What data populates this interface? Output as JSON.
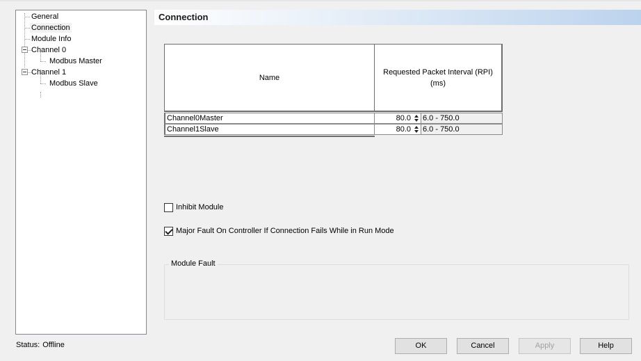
{
  "tree": {
    "items": [
      {
        "label": "General"
      },
      {
        "label": "Connection"
      },
      {
        "label": "Module Info"
      },
      {
        "label": "Channel 0"
      },
      {
        "label": "Modbus Master"
      },
      {
        "label": "Channel 1"
      },
      {
        "label": "Modbus Slave"
      }
    ]
  },
  "section": {
    "title": "Connection"
  },
  "table": {
    "headers": {
      "name": "Name",
      "rpi": "Requested Packet Interval (RPI) (ms)"
    },
    "rows": [
      {
        "name": "Channel0Master",
        "rpi": "80.0",
        "range": "6.0 - 750.0"
      },
      {
        "name": "Channel1Slave",
        "rpi": "80.0",
        "range": "6.0 - 750.0"
      }
    ]
  },
  "options": {
    "inhibit_module": {
      "label": "Inhibit Module",
      "checked": false
    },
    "major_fault": {
      "label": "Major Fault On Controller If Connection Fails While in Run Mode",
      "checked": true
    }
  },
  "module_fault": {
    "label": "Module Fault"
  },
  "status": {
    "label": "Status:",
    "value": "Offline"
  },
  "buttons": {
    "ok": "OK",
    "cancel": "Cancel",
    "apply": "Apply",
    "help": "Help"
  },
  "icons": {
    "expander": "minus-box-icon",
    "spinner": "spin-updown-icon",
    "checkmark": "checkmark-icon"
  }
}
